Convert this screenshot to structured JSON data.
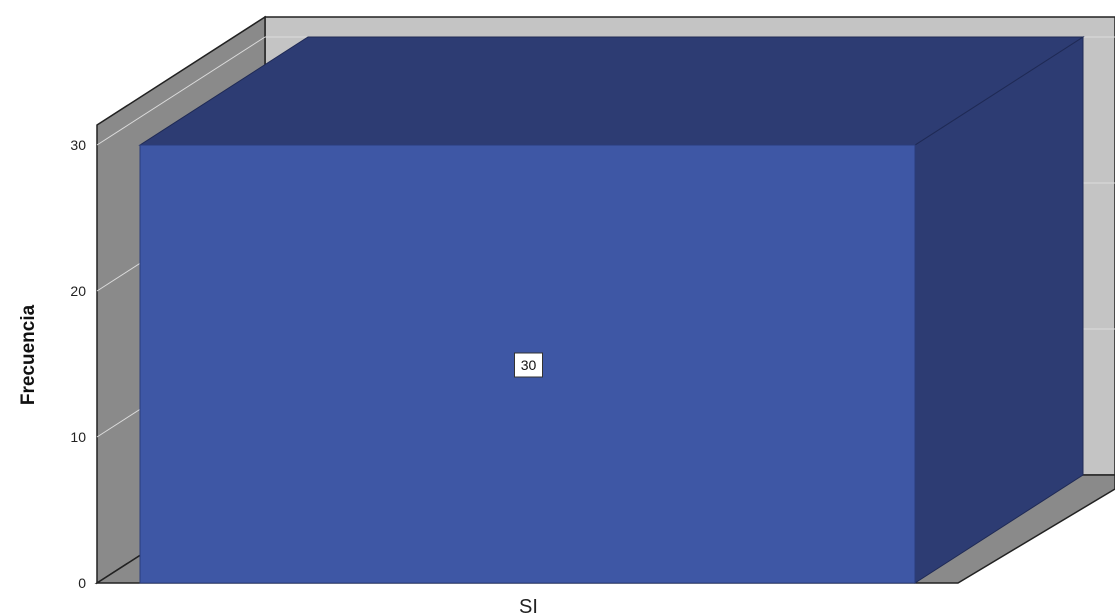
{
  "chart_data": {
    "type": "bar",
    "three_d": true,
    "categories": [
      "SI"
    ],
    "values": [
      30
    ],
    "data_labels": [
      "30"
    ],
    "title": "",
    "xlabel": "",
    "ylabel": "Frecuencia",
    "ylim": [
      0,
      30
    ],
    "yticks": [
      "0",
      "10",
      "20",
      "30"
    ],
    "grid": true,
    "legend": "none",
    "colors": {
      "bar_front": "#3e57a5",
      "bar_dark": "#2d3c73",
      "wall_side": "#8a8a8a",
      "wall_back": "#c4c4c4",
      "floor": "#8a8a8a",
      "gridline": "#dcdcdc"
    }
  }
}
